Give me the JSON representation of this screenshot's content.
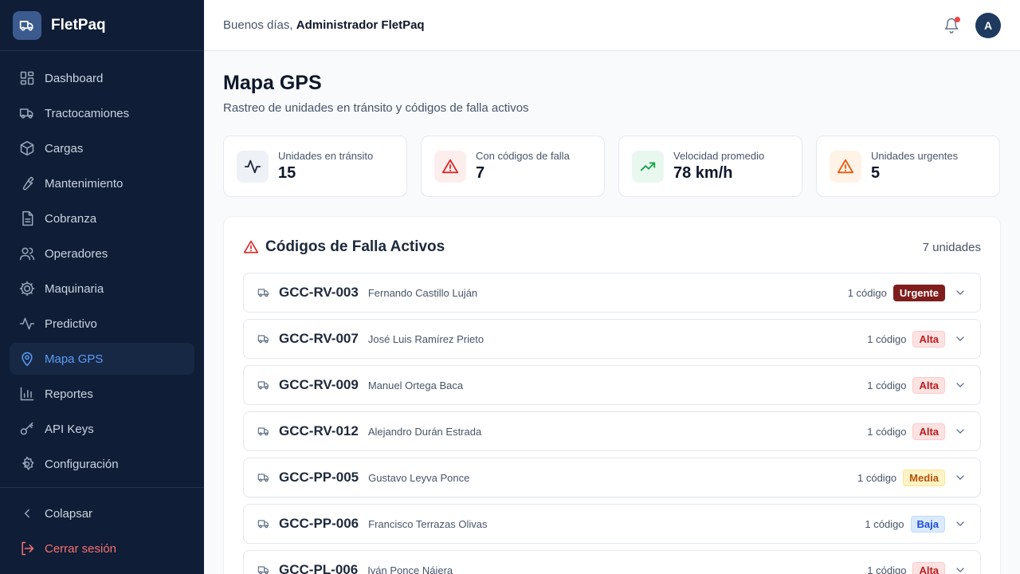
{
  "app": {
    "name": "FletPaq"
  },
  "sidebar": {
    "items": [
      {
        "label": "Dashboard",
        "icon": "dashboard-grid-icon"
      },
      {
        "label": "Tractocamiones",
        "icon": "truck-icon"
      },
      {
        "label": "Cargas",
        "icon": "package-icon"
      },
      {
        "label": "Mantenimiento",
        "icon": "wrench-icon"
      },
      {
        "label": "Cobranza",
        "icon": "document-icon"
      },
      {
        "label": "Operadores",
        "icon": "users-icon"
      },
      {
        "label": "Maquinaria",
        "icon": "cog-icon"
      },
      {
        "label": "Predictivo",
        "icon": "activity-icon"
      },
      {
        "label": "Mapa GPS",
        "icon": "map-pin-icon",
        "active": true
      },
      {
        "label": "Reportes",
        "icon": "bar-chart-icon"
      },
      {
        "label": "API Keys",
        "icon": "key-icon"
      },
      {
        "label": "Configuración",
        "icon": "settings-icon"
      }
    ],
    "collapse_label": "Colapsar",
    "logout_label": "Cerrar sesión"
  },
  "header": {
    "greeting_prefix": "Buenos días,",
    "user_name": "Administrador FletPaq",
    "avatar_initial": "A",
    "has_notifications": true
  },
  "page": {
    "title": "Mapa GPS",
    "subtitle": "Rastreo de unidades en tránsito y códigos de falla activos"
  },
  "stats": [
    {
      "label": "Unidades en tránsito",
      "value": "15",
      "icon": "activity-icon",
      "color": "#1e293b",
      "bg": "#eef2f7"
    },
    {
      "label": "Con códigos de falla",
      "value": "7",
      "icon": "alert-triangle-icon",
      "color": "#dc2626",
      "bg": "#fdeeee"
    },
    {
      "label": "Velocidad promedio",
      "value": "78 km/h",
      "icon": "trending-up-icon",
      "color": "#16a34a",
      "bg": "#e9f8ef"
    },
    {
      "label": "Unidades urgentes",
      "value": "5",
      "icon": "alert-triangle-icon",
      "color": "#ea580c",
      "bg": "#fff3e8"
    }
  ],
  "fault_panel": {
    "title": "Códigos de Falla Activos",
    "count_label": "7 unidades",
    "rows": [
      {
        "unit": "GCC-RV-003",
        "driver": "Fernando Castillo Luján",
        "codes": "1 código",
        "severity": "Urgente",
        "severity_key": "urgente"
      },
      {
        "unit": "GCC-RV-007",
        "driver": "José Luis Ramírez Prieto",
        "codes": "1 código",
        "severity": "Alta",
        "severity_key": "alta"
      },
      {
        "unit": "GCC-RV-009",
        "driver": "Manuel Ortega Baca",
        "codes": "1 código",
        "severity": "Alta",
        "severity_key": "alta"
      },
      {
        "unit": "GCC-RV-012",
        "driver": "Alejandro Durán Estrada",
        "codes": "1 código",
        "severity": "Alta",
        "severity_key": "alta"
      },
      {
        "unit": "GCC-PP-005",
        "driver": "Gustavo Leyva Ponce",
        "codes": "1 código",
        "severity": "Media",
        "severity_key": "media"
      },
      {
        "unit": "GCC-PP-006",
        "driver": "Francisco Terrazas Olivas",
        "codes": "1 código",
        "severity": "Baja",
        "severity_key": "baja"
      },
      {
        "unit": "GCC-PL-006",
        "driver": "Iván Ponce Nájera",
        "codes": "1 código",
        "severity": "Alta",
        "severity_key": "alta"
      }
    ]
  }
}
